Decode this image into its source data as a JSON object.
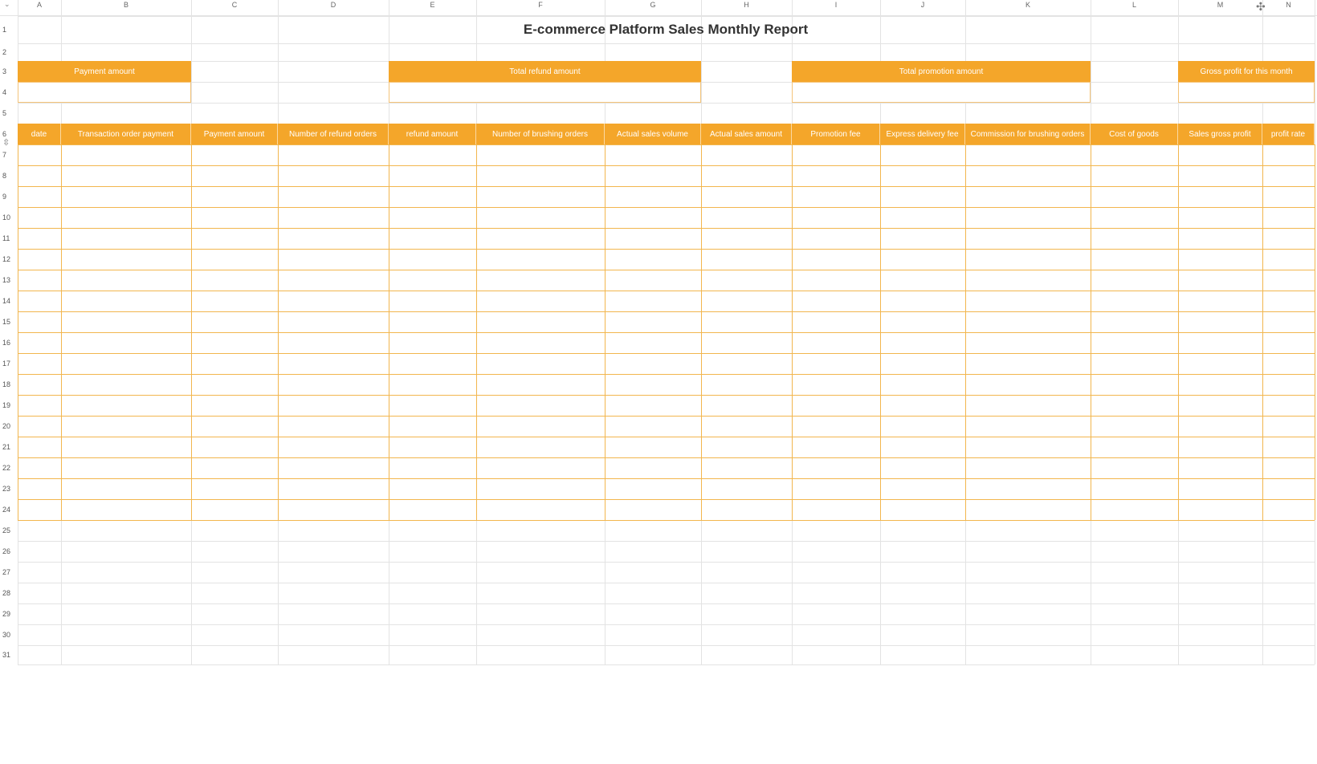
{
  "sheet": {
    "title": "E-commerce Platform Sales Monthly Report",
    "columns": [
      "A",
      "B",
      "C",
      "D",
      "E",
      "F",
      "G",
      "H",
      "I",
      "J",
      "K",
      "L",
      "M",
      "N"
    ],
    "rows": [
      "1",
      "2",
      "3",
      "4",
      "5",
      "6",
      "7",
      "8",
      "9",
      "10",
      "11",
      "12",
      "13",
      "14",
      "15",
      "16",
      "17",
      "18",
      "19",
      "20",
      "21",
      "22",
      "23",
      "24",
      "25",
      "26",
      "27",
      "28",
      "29",
      "30",
      "31"
    ],
    "summary_labels": [
      "Payment amount",
      "Total refund amount",
      "Total promotion amount",
      "Gross profit for this month"
    ],
    "table_headers": [
      "date",
      "Transaction order payment",
      "Payment amount",
      "Number of refund orders",
      "refund amount",
      "Number of brushing orders",
      "Actual sales volume",
      "Actual sales amount",
      "Promotion fee",
      "Express delivery fee",
      "Commission for brushing orders",
      "Cost of goods",
      "Sales gross profit",
      "profit rate"
    ]
  },
  "colors": {
    "accent": "#f4a62a",
    "grid": "#e3e3e3",
    "table_border": "#f2b64e"
  }
}
